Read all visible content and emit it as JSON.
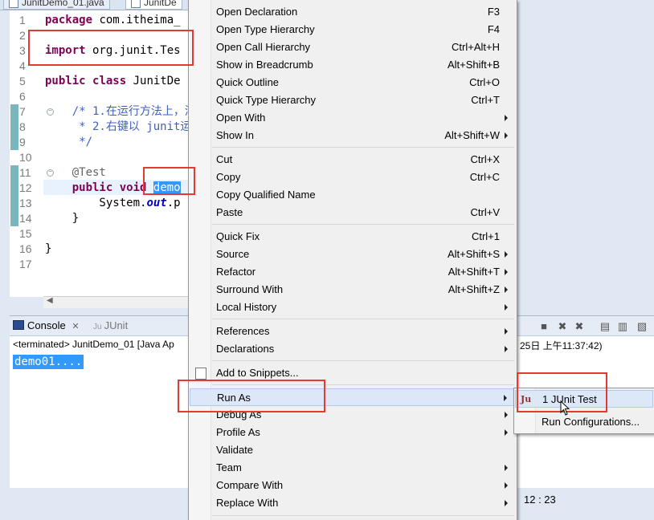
{
  "editor_tabs": [
    {
      "label": "JunitDemo_01.java"
    },
    {
      "label": "JunitDe"
    }
  ],
  "editor": {
    "line_numbers": [
      "1",
      "2",
      "3",
      "4",
      "5",
      "6",
      "7",
      "8",
      "9",
      "10",
      "11",
      "12",
      "13",
      "14",
      "15",
      "16",
      "17"
    ],
    "code": {
      "l1_kw": "package",
      "l1_rest": " com.itheima_",
      "l3_kw": "import",
      "l3_rest": " org.junit.Tes",
      "l5_kw1": "public",
      "l5_kw2": "class",
      "l5_rest": " JunitDe",
      "l7": "    /* 1.在运行方法上，添",
      "l8": "     * 2.右键以 junit运",
      "l9": "     */",
      "l11": "    @Test",
      "l12_kw1": "public",
      "l12_kw2": "void",
      "l12_sel": "demo",
      "l13_pre": "        System.",
      "l13_fld": "out",
      "l13_rest": ".p",
      "l14": "    }",
      "l16": "}"
    }
  },
  "console": {
    "tab_console": "Console",
    "tab_junit": "JUnit",
    "header": "<terminated> JunitDemo_01 [Java Ap",
    "header_tail": "25日 上午11:37:42)",
    "output": "demo01...."
  },
  "status": {
    "position": "12 : 23"
  },
  "context_menu": {
    "items": [
      {
        "label": "Open Declaration",
        "shortcut": "F3"
      },
      {
        "label": "Open Type Hierarchy",
        "shortcut": "F4"
      },
      {
        "label": "Open Call Hierarchy",
        "shortcut": "Ctrl+Alt+H"
      },
      {
        "label": "Show in Breadcrumb",
        "shortcut": "Alt+Shift+B"
      },
      {
        "label": "Quick Outline",
        "shortcut": "Ctrl+O"
      },
      {
        "label": "Quick Type Hierarchy",
        "shortcut": "Ctrl+T"
      },
      {
        "label": "Open With",
        "shortcut": ""
      },
      {
        "label": "Show In",
        "shortcut": "Alt+Shift+W"
      },
      {
        "label": "Cut",
        "shortcut": "Ctrl+X"
      },
      {
        "label": "Copy",
        "shortcut": "Ctrl+C"
      },
      {
        "label": "Copy Qualified Name",
        "shortcut": ""
      },
      {
        "label": "Paste",
        "shortcut": "Ctrl+V"
      },
      {
        "label": "Quick Fix",
        "shortcut": "Ctrl+1"
      },
      {
        "label": "Source",
        "shortcut": "Alt+Shift+S"
      },
      {
        "label": "Refactor",
        "shortcut": "Alt+Shift+T"
      },
      {
        "label": "Surround With",
        "shortcut": "Alt+Shift+Z"
      },
      {
        "label": "Local History",
        "shortcut": ""
      },
      {
        "label": "References",
        "shortcut": ""
      },
      {
        "label": "Declarations",
        "shortcut": ""
      },
      {
        "label": "Add to Snippets...",
        "shortcut": ""
      },
      {
        "label": "Run As",
        "shortcut": ""
      },
      {
        "label": "Debug As",
        "shortcut": ""
      },
      {
        "label": "Profile As",
        "shortcut": ""
      },
      {
        "label": "Validate",
        "shortcut": ""
      },
      {
        "label": "Team",
        "shortcut": ""
      },
      {
        "label": "Compare With",
        "shortcut": ""
      },
      {
        "label": "Replace With",
        "shortcut": ""
      }
    ]
  },
  "run_as_submenu": {
    "items": [
      {
        "label": "1 JUnit Test",
        "icon": "Ju"
      },
      {
        "label": "Run Configurations..."
      }
    ]
  }
}
